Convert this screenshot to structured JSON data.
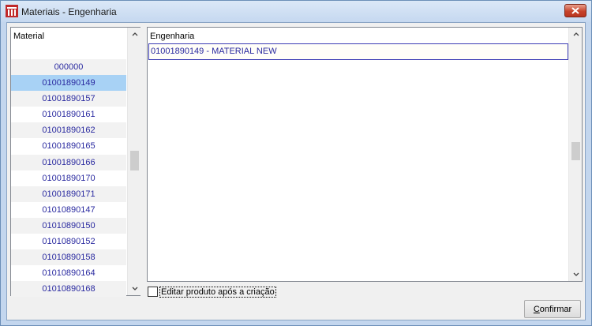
{
  "window": {
    "title": "Materiais - Engenharia"
  },
  "material_list": {
    "header": "Material",
    "items": [
      "000000",
      "01001890149",
      "01001890157",
      "01001890161",
      "01001890162",
      "01001890165",
      "01001890166",
      "01001890170",
      "01001890171",
      "01010890147",
      "01010890150",
      "01010890152",
      "01010890158",
      "01010890164",
      "01010890168"
    ],
    "selected_index": 1
  },
  "engineering_grid": {
    "header": "Engenharia",
    "rows": [
      "01001890149 - MATERIAL NEW"
    ]
  },
  "edit_checkbox": {
    "label": "Editar produto após a criação",
    "checked": false
  },
  "confirm_button": {
    "label_first": "C",
    "label_rest": "onfirmar"
  },
  "colors": {
    "list_text": "#2a2aa0",
    "selected_row": "#a8d2f5",
    "close_button": "#c7432b"
  },
  "icons": {
    "app": "app-logo-icon",
    "close": "close-icon",
    "scroll_up": "chevron-up-icon",
    "scroll_down": "chevron-down-icon"
  }
}
